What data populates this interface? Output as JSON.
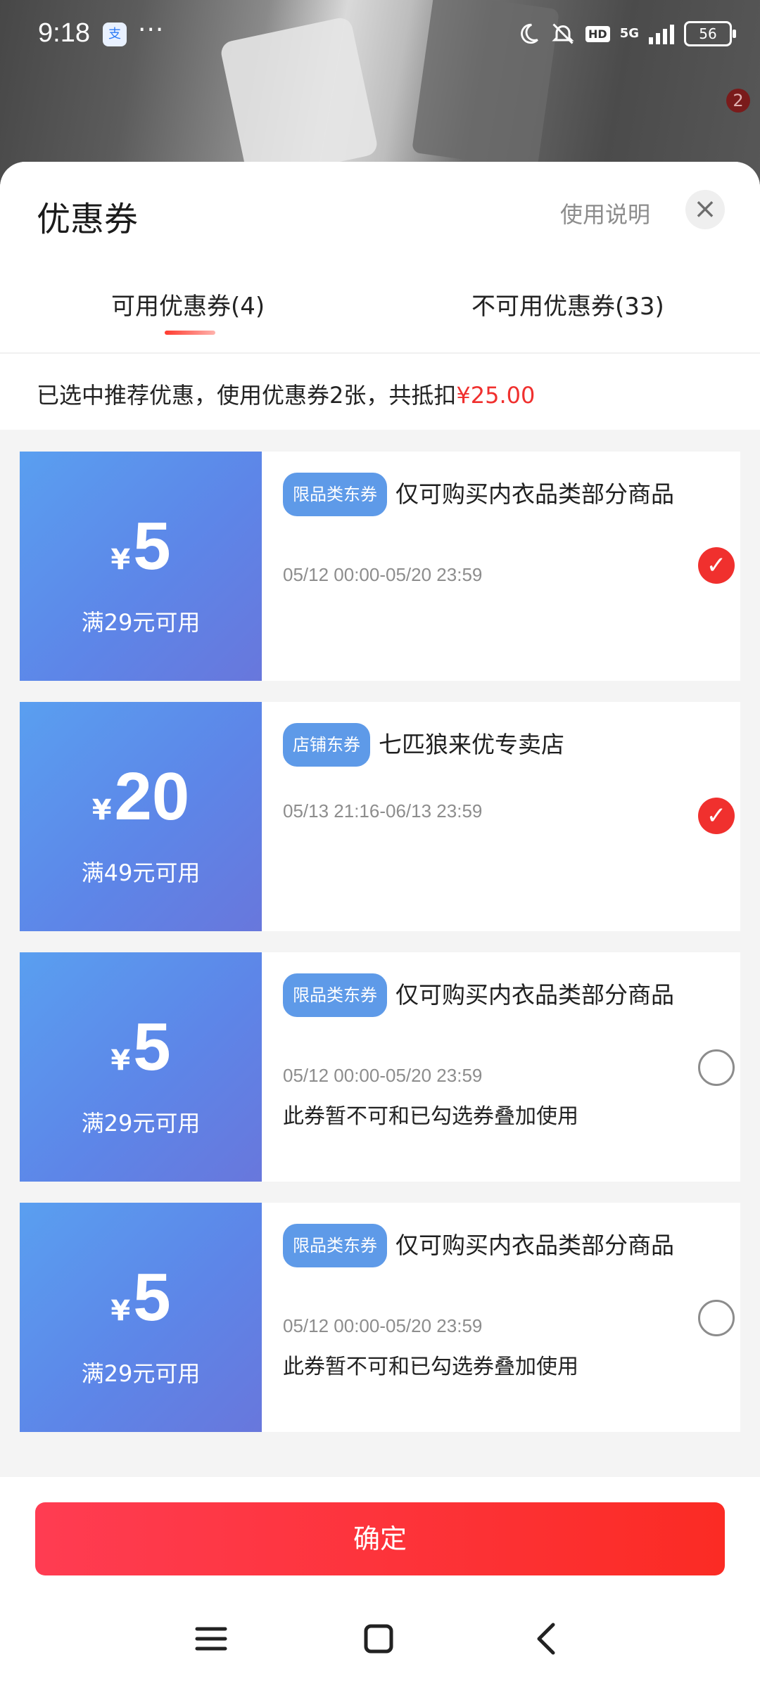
{
  "status_bar": {
    "time": "9:18",
    "app_icon_glyph": "支",
    "more": "···",
    "network": "5G",
    "hd": "HD",
    "battery": "56"
  },
  "background": {
    "badge_count": "2"
  },
  "sheet": {
    "title": "优惠券",
    "help_link": "使用说明",
    "close_glyph": "×",
    "tabs": [
      {
        "label": "可用优惠券(4)",
        "active": true
      },
      {
        "label": "不可用优惠券(33)",
        "active": false
      }
    ],
    "summary_prefix": "已选中推荐优惠，使用优惠券2张，共抵扣",
    "summary_amount": "¥25.00"
  },
  "coupons": [
    {
      "currency": "¥",
      "amount": "5",
      "condition": "满29元可用",
      "tag": "限品类东券",
      "title": "仅可购买内衣品类部分商品",
      "date": "05/12 00:00-05/20 23:59",
      "note": "",
      "selected": true
    },
    {
      "currency": "¥",
      "amount": "20",
      "condition": "满49元可用",
      "tag": "店铺东券",
      "title": "七匹狼来优专卖店",
      "date": "05/13 21:16-06/13 23:59",
      "note": "",
      "selected": true
    },
    {
      "currency": "¥",
      "amount": "5",
      "condition": "满29元可用",
      "tag": "限品类东券",
      "title": "仅可购买内衣品类部分商品",
      "date": "05/12 00:00-05/20 23:59",
      "note": "此券暂不可和已勾选券叠加使用",
      "selected": false
    },
    {
      "currency": "¥",
      "amount": "5",
      "condition": "满29元可用",
      "tag": "限品类东券",
      "title": "仅可购买内衣品类部分商品",
      "date": "05/12 00:00-05/20 23:59",
      "note": "此券暂不可和已勾选券叠加使用",
      "selected": false
    }
  ],
  "footer": {
    "confirm_label": "确定"
  },
  "colors": {
    "accent_red": "#f0302e",
    "coupon_blue": "#5d86e8",
    "tag_blue": "#5e9ae8"
  }
}
